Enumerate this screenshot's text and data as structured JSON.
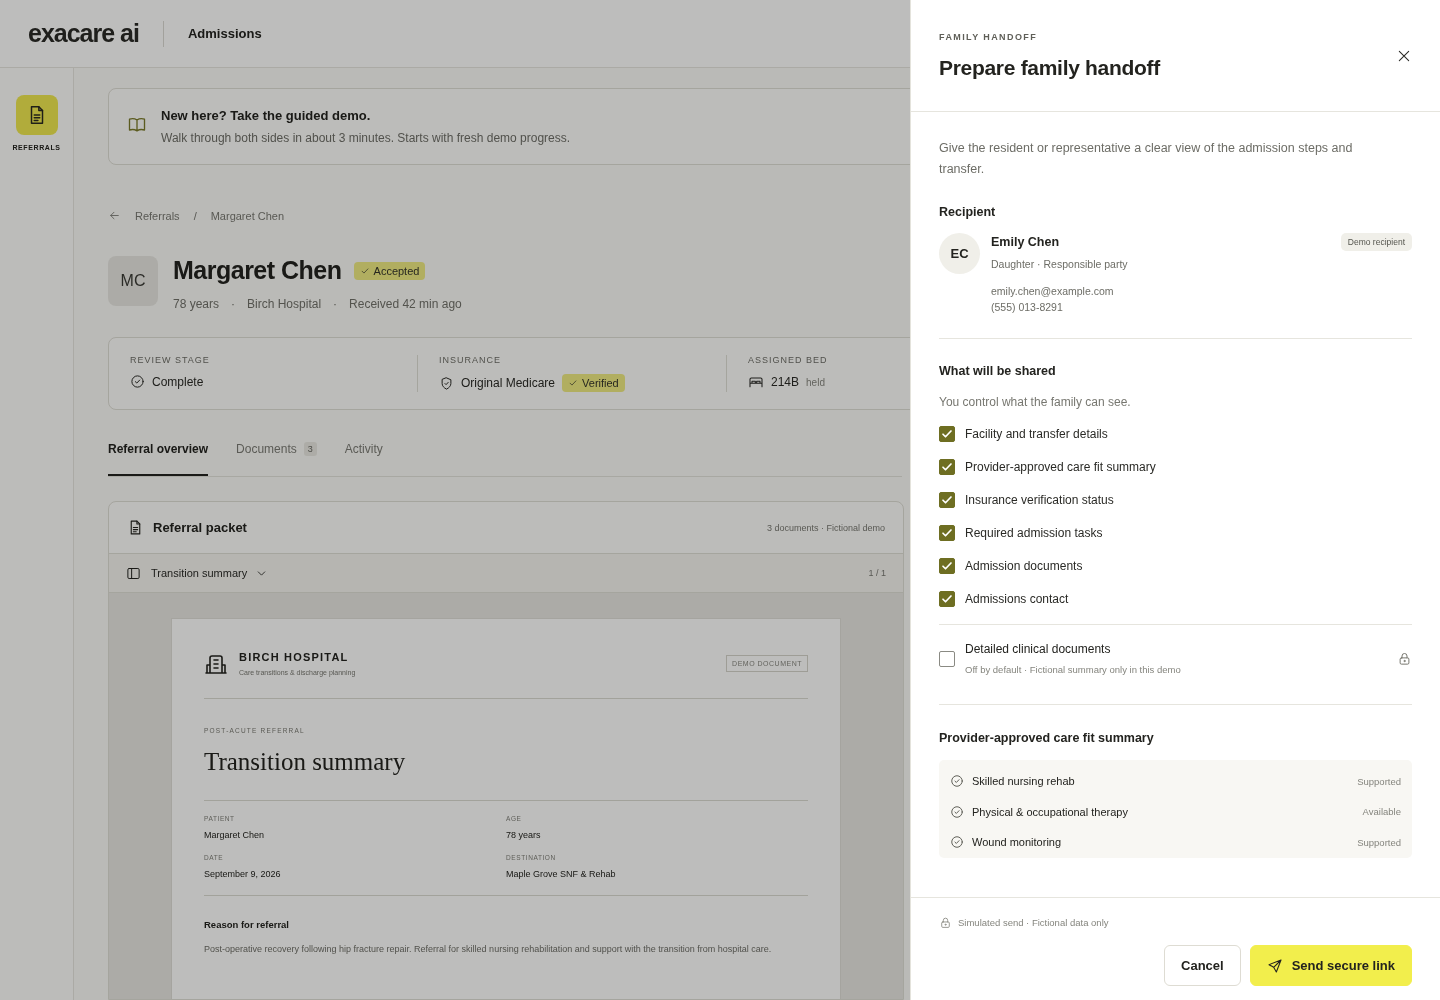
{
  "app": {
    "logo": "exacare ai",
    "section": "Admissions"
  },
  "sidebar": {
    "items": [
      {
        "label": "REFERRALS",
        "selected": true
      }
    ]
  },
  "banner": {
    "title": "New here? Take the guided demo.",
    "text": "Walk through both sides in about 3 minutes. Starts with fresh demo progress."
  },
  "breadcrumb": [
    "Referrals",
    "/",
    "Margaret Chen"
  ],
  "patient": {
    "initials": "MC",
    "name": "Margaret Chen",
    "status": "Accepted",
    "meta": [
      "78 years",
      "Birch Hospital",
      "Received 42 min ago"
    ],
    "meta_separator": "·"
  },
  "stats": [
    {
      "kind": "stage",
      "label": "REVIEW STAGE",
      "value": "Complete"
    },
    {
      "kind": "insurance",
      "label": "INSURANCE",
      "value": "Original Medicare",
      "badge": "Verified"
    },
    {
      "kind": "bed",
      "label": "ASSIGNED BED",
      "value": "214B",
      "note": "held"
    }
  ],
  "tabs": [
    {
      "label": "Referral overview",
      "selected": true
    },
    {
      "label": "Documents",
      "count": "3",
      "selected": false
    },
    {
      "label": "Activity",
      "selected": false
    }
  ],
  "packet": {
    "title": "Referral packet",
    "meta": "3 documents · Fictional demo",
    "document_picker": "Transition summary",
    "page": "1 / 1",
    "document": {
      "facility": "BIRCH HOSPITAL",
      "facility_sub": "Care transitions & discharge planning",
      "badge": "DEMO DOCUMENT",
      "eyebrow": "POST-ACUTE REFERRAL",
      "title": "Transition summary",
      "fields": [
        {
          "label": "PATIENT",
          "value": "Margaret Chen"
        },
        {
          "label": "AGE",
          "value": "78 years"
        },
        {
          "label": "DATE",
          "value": "September 9, 2026"
        },
        {
          "label": "DESTINATION",
          "value": "Maple Grove SNF & Rehab"
        }
      ],
      "section_title": "Reason for referral",
      "section_text": "Post-operative recovery following hip fracture repair. Referral for skilled nursing rehabilitation and support with the transition from hospital care."
    }
  },
  "drawer": {
    "eyebrow": "FAMILY HANDOFF",
    "title": "Prepare family handoff",
    "intro": "Give the resident or representative a clear view of the admission steps and transfer.",
    "recipient": {
      "heading": "Recipient",
      "initials": "EC",
      "name": "Emily Chen",
      "relation": "Daughter · Responsible party",
      "email": "emily.chen@example.com",
      "phone": "(555) 013-8291",
      "badge": "Demo recipient"
    },
    "shared": {
      "title": "What will be shared",
      "subtitle": "You control what the family can see.",
      "items": [
        {
          "label": "Facility and transfer details",
          "checked": true
        },
        {
          "label": "Provider-approved care fit summary",
          "checked": true
        },
        {
          "label": "Insurance verification status",
          "checked": true
        },
        {
          "label": "Required admission tasks",
          "checked": true
        },
        {
          "label": "Admission documents",
          "checked": true
        },
        {
          "label": "Admissions contact",
          "checked": true
        }
      ],
      "restricted": {
        "label": "Detailed clinical documents",
        "note": "Off by default · Fictional summary only in this demo",
        "checked": false
      }
    },
    "care_fit": {
      "title": "Provider-approved care fit summary",
      "items": [
        {
          "label": "Skilled nursing rehab",
          "status": "Supported"
        },
        {
          "label": "Physical & occupational therapy",
          "status": "Available"
        },
        {
          "label": "Wound monitoring",
          "status": "Supported"
        }
      ]
    },
    "footer": {
      "note": "Simulated send · Fictional data only",
      "cancel": "Cancel",
      "send": "Send secure link"
    }
  }
}
